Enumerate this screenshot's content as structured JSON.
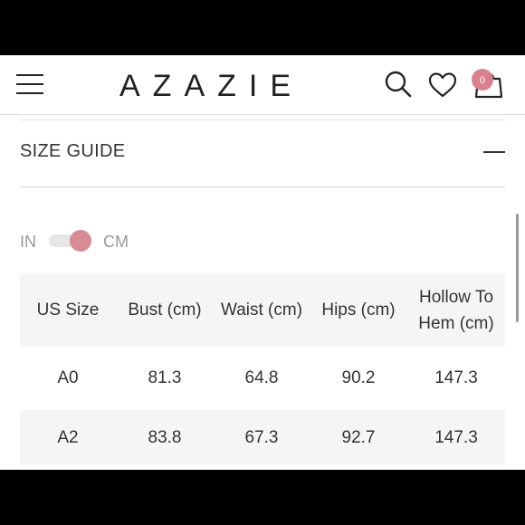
{
  "header": {
    "logo": "AZAZIE",
    "bag_count": "0"
  },
  "section": {
    "title": "SIZE GUIDE"
  },
  "unit_toggle": {
    "left_label": "IN",
    "right_label": "CM",
    "selected": "CM"
  },
  "table": {
    "columns": [
      "US Size",
      "Bust (cm)",
      "Waist (cm)",
      "Hips (cm)",
      "Hollow To Hem (cm)"
    ],
    "rows": [
      [
        "A0",
        "81.3",
        "64.8",
        "90.2",
        "147.3"
      ],
      [
        "A2",
        "83.8",
        "67.3",
        "92.7",
        "147.3"
      ]
    ]
  },
  "colors": {
    "accent": "#d68b95",
    "badge": "#d9828f",
    "row_shade": "#f5f5f5"
  },
  "icons": [
    "menu-icon",
    "search-icon",
    "heart-icon",
    "shopping-bag-icon",
    "collapse-icon"
  ]
}
